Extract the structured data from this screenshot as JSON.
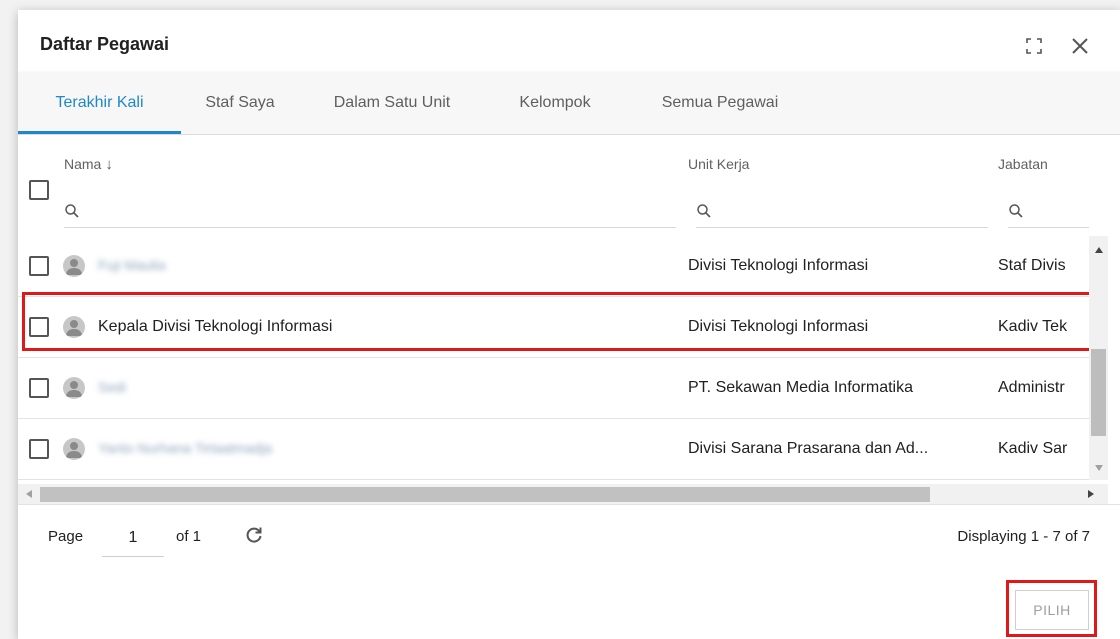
{
  "dialog": {
    "title": "Daftar Pegawai"
  },
  "tabs": [
    {
      "label": "Terakhir Kali",
      "active": true
    },
    {
      "label": "Staf Saya",
      "active": false
    },
    {
      "label": "Dalam Satu Unit",
      "active": false
    },
    {
      "label": "Kelompok",
      "active": false
    },
    {
      "label": "Semua Pegawai",
      "active": false
    }
  ],
  "columns": {
    "name": "Nama",
    "sort_indicator": "↓",
    "unit": "Unit Kerja",
    "position": "Jabatan"
  },
  "rows": [
    {
      "name": "Fuji Maulia",
      "name_blurred": true,
      "unit": "Divisi Teknologi Informasi",
      "position": "Staf Divis"
    },
    {
      "name": "Kepala Divisi Teknologi Informasi",
      "name_blurred": false,
      "unit": "Divisi Teknologi Informasi",
      "position": "Kadiv Tek"
    },
    {
      "name": "Sedi",
      "name_blurred": true,
      "unit": "PT. Sekawan Media Informatika",
      "position": "Administr"
    },
    {
      "name": "Yanto Nurhana Tirtaatmadja",
      "name_blurred": true,
      "unit": "Divisi Sarana Prasarana dan Ad...",
      "position": "Kadiv Sar"
    }
  ],
  "pager": {
    "page_label": "Page",
    "page_value": "1",
    "of_label": "of 1",
    "display_text": "Displaying 1 - 7 of 7"
  },
  "footer": {
    "select_label": "PILIH"
  },
  "colors": {
    "accent": "#1e88c8",
    "highlight": "#e01818"
  },
  "icons": {
    "expand": "expand-icon",
    "close": "close-icon",
    "search": "search-icon",
    "refresh": "refresh-icon",
    "avatar": "user-avatar-icon"
  }
}
